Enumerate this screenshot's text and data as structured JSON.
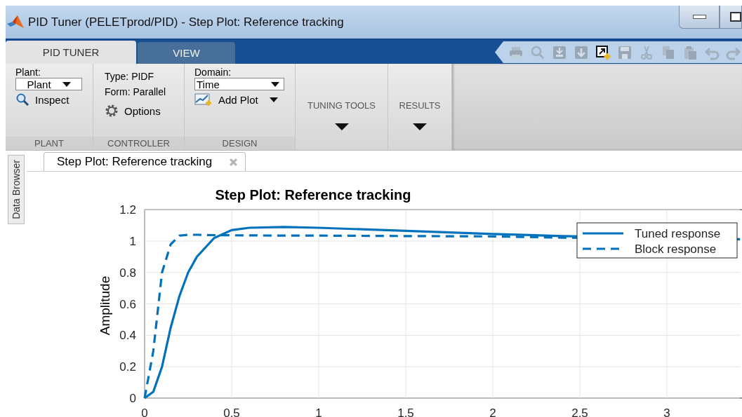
{
  "window": {
    "title": "PID Tuner (PELETprod/PID) - Step Plot: Reference tracking"
  },
  "tabs": [
    {
      "label": "PID TUNER",
      "selected": true
    },
    {
      "label": "VIEW",
      "selected": false
    }
  ],
  "toolbar": [
    {
      "kind": "print",
      "disabled": true
    },
    {
      "kind": "zoom",
      "disabled": true
    },
    {
      "kind": "dock",
      "disabled": true
    },
    {
      "kind": "download",
      "disabled": true
    },
    {
      "kind": "new-figure",
      "disabled": false
    },
    {
      "kind": "save",
      "disabled": true
    },
    {
      "kind": "cut",
      "disabled": true
    },
    {
      "kind": "copy",
      "disabled": true
    },
    {
      "kind": "paste",
      "disabled": true
    },
    {
      "kind": "undo",
      "disabled": true
    },
    {
      "kind": "redo",
      "disabled": true
    }
  ],
  "ribbon": {
    "plant": {
      "label": "Plant:",
      "dropdown": "Plant",
      "button": "Inspect",
      "group": "PLANT"
    },
    "controller": {
      "type": "Type: PIDF",
      "form": "Form: Parallel",
      "button": "Options",
      "group": "CONTROLLER"
    },
    "design": {
      "label": "Domain:",
      "dropdown": "Time",
      "button": "Add Plot",
      "group": "DESIGN"
    },
    "menus": [
      {
        "label": "TUNING TOOLS"
      },
      {
        "label": "RESULTS"
      }
    ]
  },
  "side_panel": {
    "label": "Data Browser"
  },
  "document_tab": {
    "label": "Step Plot: Reference tracking"
  },
  "chart_data": {
    "type": "line",
    "title": "Step Plot: Reference tracking",
    "ylabel": "Amplitude",
    "x": [
      0,
      0.05,
      0.1,
      0.15,
      0.2,
      0.25,
      0.3,
      0.4,
      0.5,
      0.6,
      0.8,
      1,
      1.5,
      2,
      2.4,
      3.42
    ],
    "series": [
      {
        "name": "Tuned response",
        "color": "#0072bd",
        "line_style": "solid",
        "values": [
          0,
          0.04,
          0.2,
          0.45,
          0.65,
          0.8,
          0.9,
          1.02,
          1.07,
          1.085,
          1.09,
          1.085,
          1.065,
          1.045,
          1.032,
          1.012
        ]
      },
      {
        "name": "Block response",
        "color": "#0072bd",
        "line_style": "dashed",
        "values": [
          0,
          0.3,
          0.8,
          0.98,
          1.035,
          1.04,
          1.04,
          1.038,
          1.037,
          1.036,
          1.035,
          1.035,
          1.032,
          1.03,
          1.022,
          1.01
        ]
      }
    ],
    "xlim": [
      0,
      3.42
    ],
    "ylim": [
      0,
      1.2
    ],
    "grid": true,
    "legend": true,
    "xticks": [
      0,
      0.5,
      1,
      1.5,
      2,
      2.5,
      3
    ],
    "yticks": [
      0,
      0.2,
      0.4,
      0.6,
      0.8,
      1,
      1.2
    ]
  }
}
